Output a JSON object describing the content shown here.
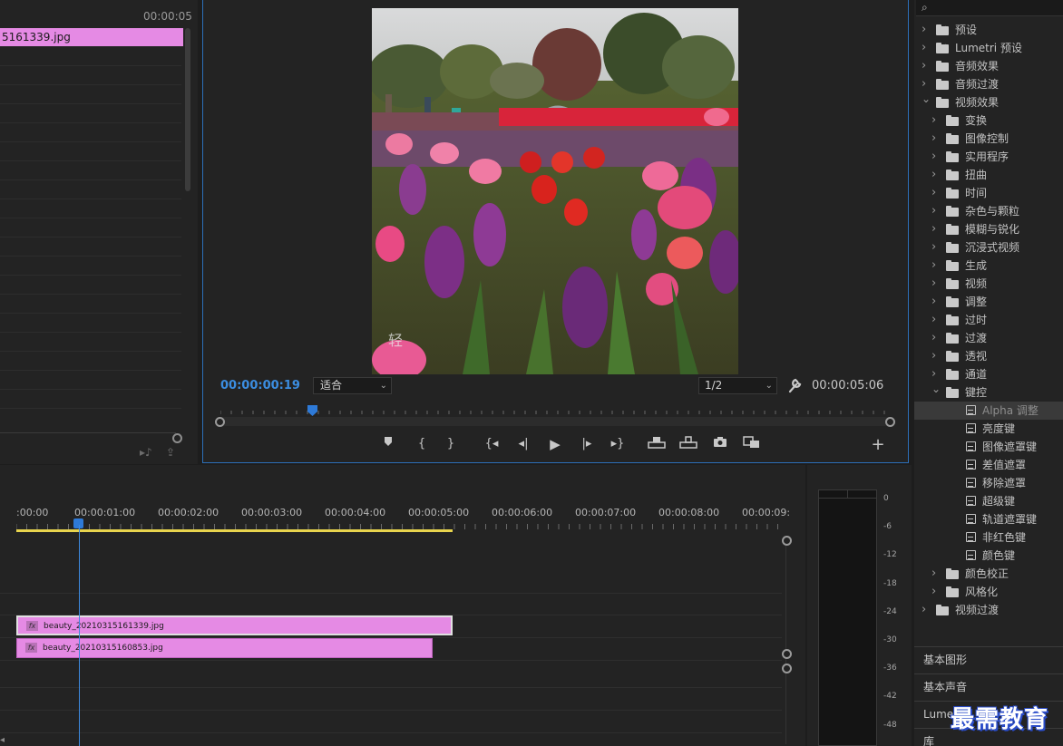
{
  "source_monitor": {
    "timecode": "00:00:05",
    "clip_name": "5161339.jpg"
  },
  "program_monitor": {
    "current_timecode": "00:00:00:19",
    "fit_select": "适合",
    "resolution_select": "1/2",
    "duration_timecode": "00:00:05:06",
    "image_overlay_text": "轻"
  },
  "timeline": {
    "ruler_labels": [
      ":00:00",
      "00:00:01:00",
      "00:00:02:00",
      "00:00:03:00",
      "00:00:04:00",
      "00:00:05:00",
      "00:00:06:00",
      "00:00:07:00",
      "00:00:08:00",
      "00:00:09:"
    ],
    "clips": [
      {
        "name": "beauty_20210315161339.jpg",
        "fx": "fx"
      },
      {
        "name": "beauty_20210315160853.jpg",
        "fx": "fx"
      }
    ]
  },
  "audio_meter": {
    "db_labels": [
      "0",
      "-6",
      "-12",
      "-18",
      "-24",
      "-30",
      "-36",
      "-42",
      "-48"
    ]
  },
  "effects_panel": {
    "items": [
      {
        "label": "预设",
        "level": 0,
        "expanded": false,
        "type": "folder-star"
      },
      {
        "label": "Lumetri 预设",
        "level": 0,
        "expanded": false,
        "type": "folder-star"
      },
      {
        "label": "音频效果",
        "level": 0,
        "expanded": false,
        "type": "folder"
      },
      {
        "label": "音频过渡",
        "level": 0,
        "expanded": false,
        "type": "folder"
      },
      {
        "label": "视频效果",
        "level": 0,
        "expanded": true,
        "type": "folder"
      },
      {
        "label": "变换",
        "level": 1,
        "expanded": false,
        "type": "folder"
      },
      {
        "label": "图像控制",
        "level": 1,
        "expanded": false,
        "type": "folder"
      },
      {
        "label": "实用程序",
        "level": 1,
        "expanded": false,
        "type": "folder"
      },
      {
        "label": "扭曲",
        "level": 1,
        "expanded": false,
        "type": "folder"
      },
      {
        "label": "时间",
        "level": 1,
        "expanded": false,
        "type": "folder"
      },
      {
        "label": "杂色与颗粒",
        "level": 1,
        "expanded": false,
        "type": "folder"
      },
      {
        "label": "模糊与锐化",
        "level": 1,
        "expanded": false,
        "type": "folder"
      },
      {
        "label": "沉浸式视频",
        "level": 1,
        "expanded": false,
        "type": "folder"
      },
      {
        "label": "生成",
        "level": 1,
        "expanded": false,
        "type": "folder"
      },
      {
        "label": "视频",
        "level": 1,
        "expanded": false,
        "type": "folder"
      },
      {
        "label": "调整",
        "level": 1,
        "expanded": false,
        "type": "folder"
      },
      {
        "label": "过时",
        "level": 1,
        "expanded": false,
        "type": "folder"
      },
      {
        "label": "过渡",
        "level": 1,
        "expanded": false,
        "type": "folder"
      },
      {
        "label": "透视",
        "level": 1,
        "expanded": false,
        "type": "folder"
      },
      {
        "label": "通道",
        "level": 1,
        "expanded": false,
        "type": "folder"
      },
      {
        "label": "键控",
        "level": 1,
        "expanded": true,
        "type": "folder"
      },
      {
        "label": "Alpha 调整",
        "level": 2,
        "type": "effect",
        "selected": true
      },
      {
        "label": "亮度键",
        "level": 2,
        "type": "effect"
      },
      {
        "label": "图像遮罩键",
        "level": 2,
        "type": "effect"
      },
      {
        "label": "差值遮罩",
        "level": 2,
        "type": "effect"
      },
      {
        "label": "移除遮罩",
        "level": 2,
        "type": "effect"
      },
      {
        "label": "超级键",
        "level": 2,
        "type": "effect"
      },
      {
        "label": "轨道遮罩键",
        "level": 2,
        "type": "effect"
      },
      {
        "label": "非红色键",
        "level": 2,
        "type": "effect"
      },
      {
        "label": "颜色键",
        "level": 2,
        "type": "effect"
      },
      {
        "label": "颜色校正",
        "level": 1,
        "expanded": false,
        "type": "folder"
      },
      {
        "label": "风格化",
        "level": 1,
        "expanded": false,
        "type": "folder"
      },
      {
        "label": "视频过渡",
        "level": 0,
        "expanded": false,
        "type": "folder"
      }
    ],
    "tabs": [
      "基本图形",
      "基本声音",
      "Lumetri",
      "库"
    ]
  },
  "watermark": "最需教育",
  "icons": {
    "search": "search-icon",
    "wrench": "wrench-icon"
  },
  "colors": {
    "accent": "#2e7ad8",
    "clip": "#e58ae4",
    "work_area": "#e8d44d"
  }
}
